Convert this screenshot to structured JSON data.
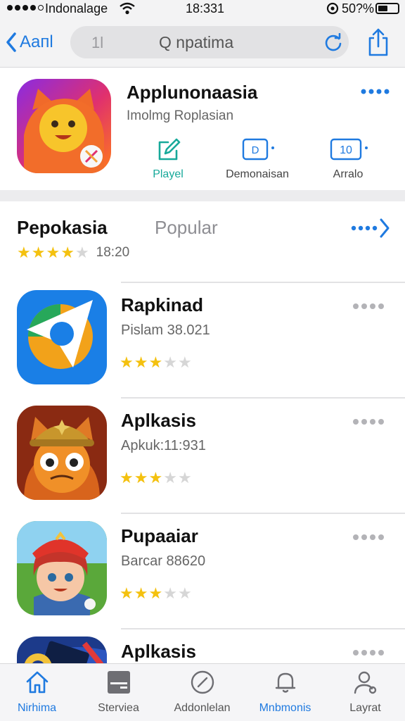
{
  "status_bar": {
    "carrier": "Indonalage",
    "time": "18:331",
    "battery": "50?%",
    "battery_level": 0.5
  },
  "nav": {
    "back_label": "Aaпl",
    "search_prefix": "1l",
    "search_placeholder": "Q npatima"
  },
  "featured": {
    "title": "Applunonaasia",
    "subtitle": "Imolmg Roplasian",
    "actions": [
      {
        "label": "Playel",
        "icon": "edit-icon",
        "badge": ""
      },
      {
        "label": "Demonaisan",
        "icon": "badge-icon",
        "badge": "D"
      },
      {
        "label": "Arralo",
        "icon": "badge-icon",
        "badge": "10"
      }
    ]
  },
  "section": {
    "tab_active": "Pepokasia",
    "tab_popular": "Popular",
    "rating": 4,
    "rating_value": "18:20"
  },
  "apps": [
    {
      "title": "Rapkinad",
      "subtitle": "Pislam 38.021",
      "rating": 3,
      "icon": "compass-logo-icon"
    },
    {
      "title": "Aplkasis",
      "subtitle": "Apkuk:11:931",
      "rating": 3,
      "icon": "cat-helmet-icon"
    },
    {
      "title": "Pupaaiar",
      "subtitle": "Barcar 88620",
      "rating": 3,
      "icon": "kid-character-icon"
    },
    {
      "title": "Aplkasis",
      "subtitle": "",
      "rating": 0,
      "icon": "game-art-icon"
    }
  ],
  "tabs": [
    {
      "label": "Nirhima",
      "icon": "home-icon",
      "active": true
    },
    {
      "label": "Sterviea",
      "icon": "tray-icon",
      "active": false
    },
    {
      "label": "Addonlelan",
      "icon": "compass-icon",
      "active": false
    },
    {
      "label": "Mnbmonis",
      "icon": "bell-icon",
      "active": true
    },
    {
      "label": "Layrat",
      "icon": "person-icon",
      "active": false
    }
  ],
  "colors": {
    "accent": "#1f7ae0",
    "play_green": "#17a99a",
    "star": "#f4c10f",
    "star_off": "#d6d6d6"
  }
}
